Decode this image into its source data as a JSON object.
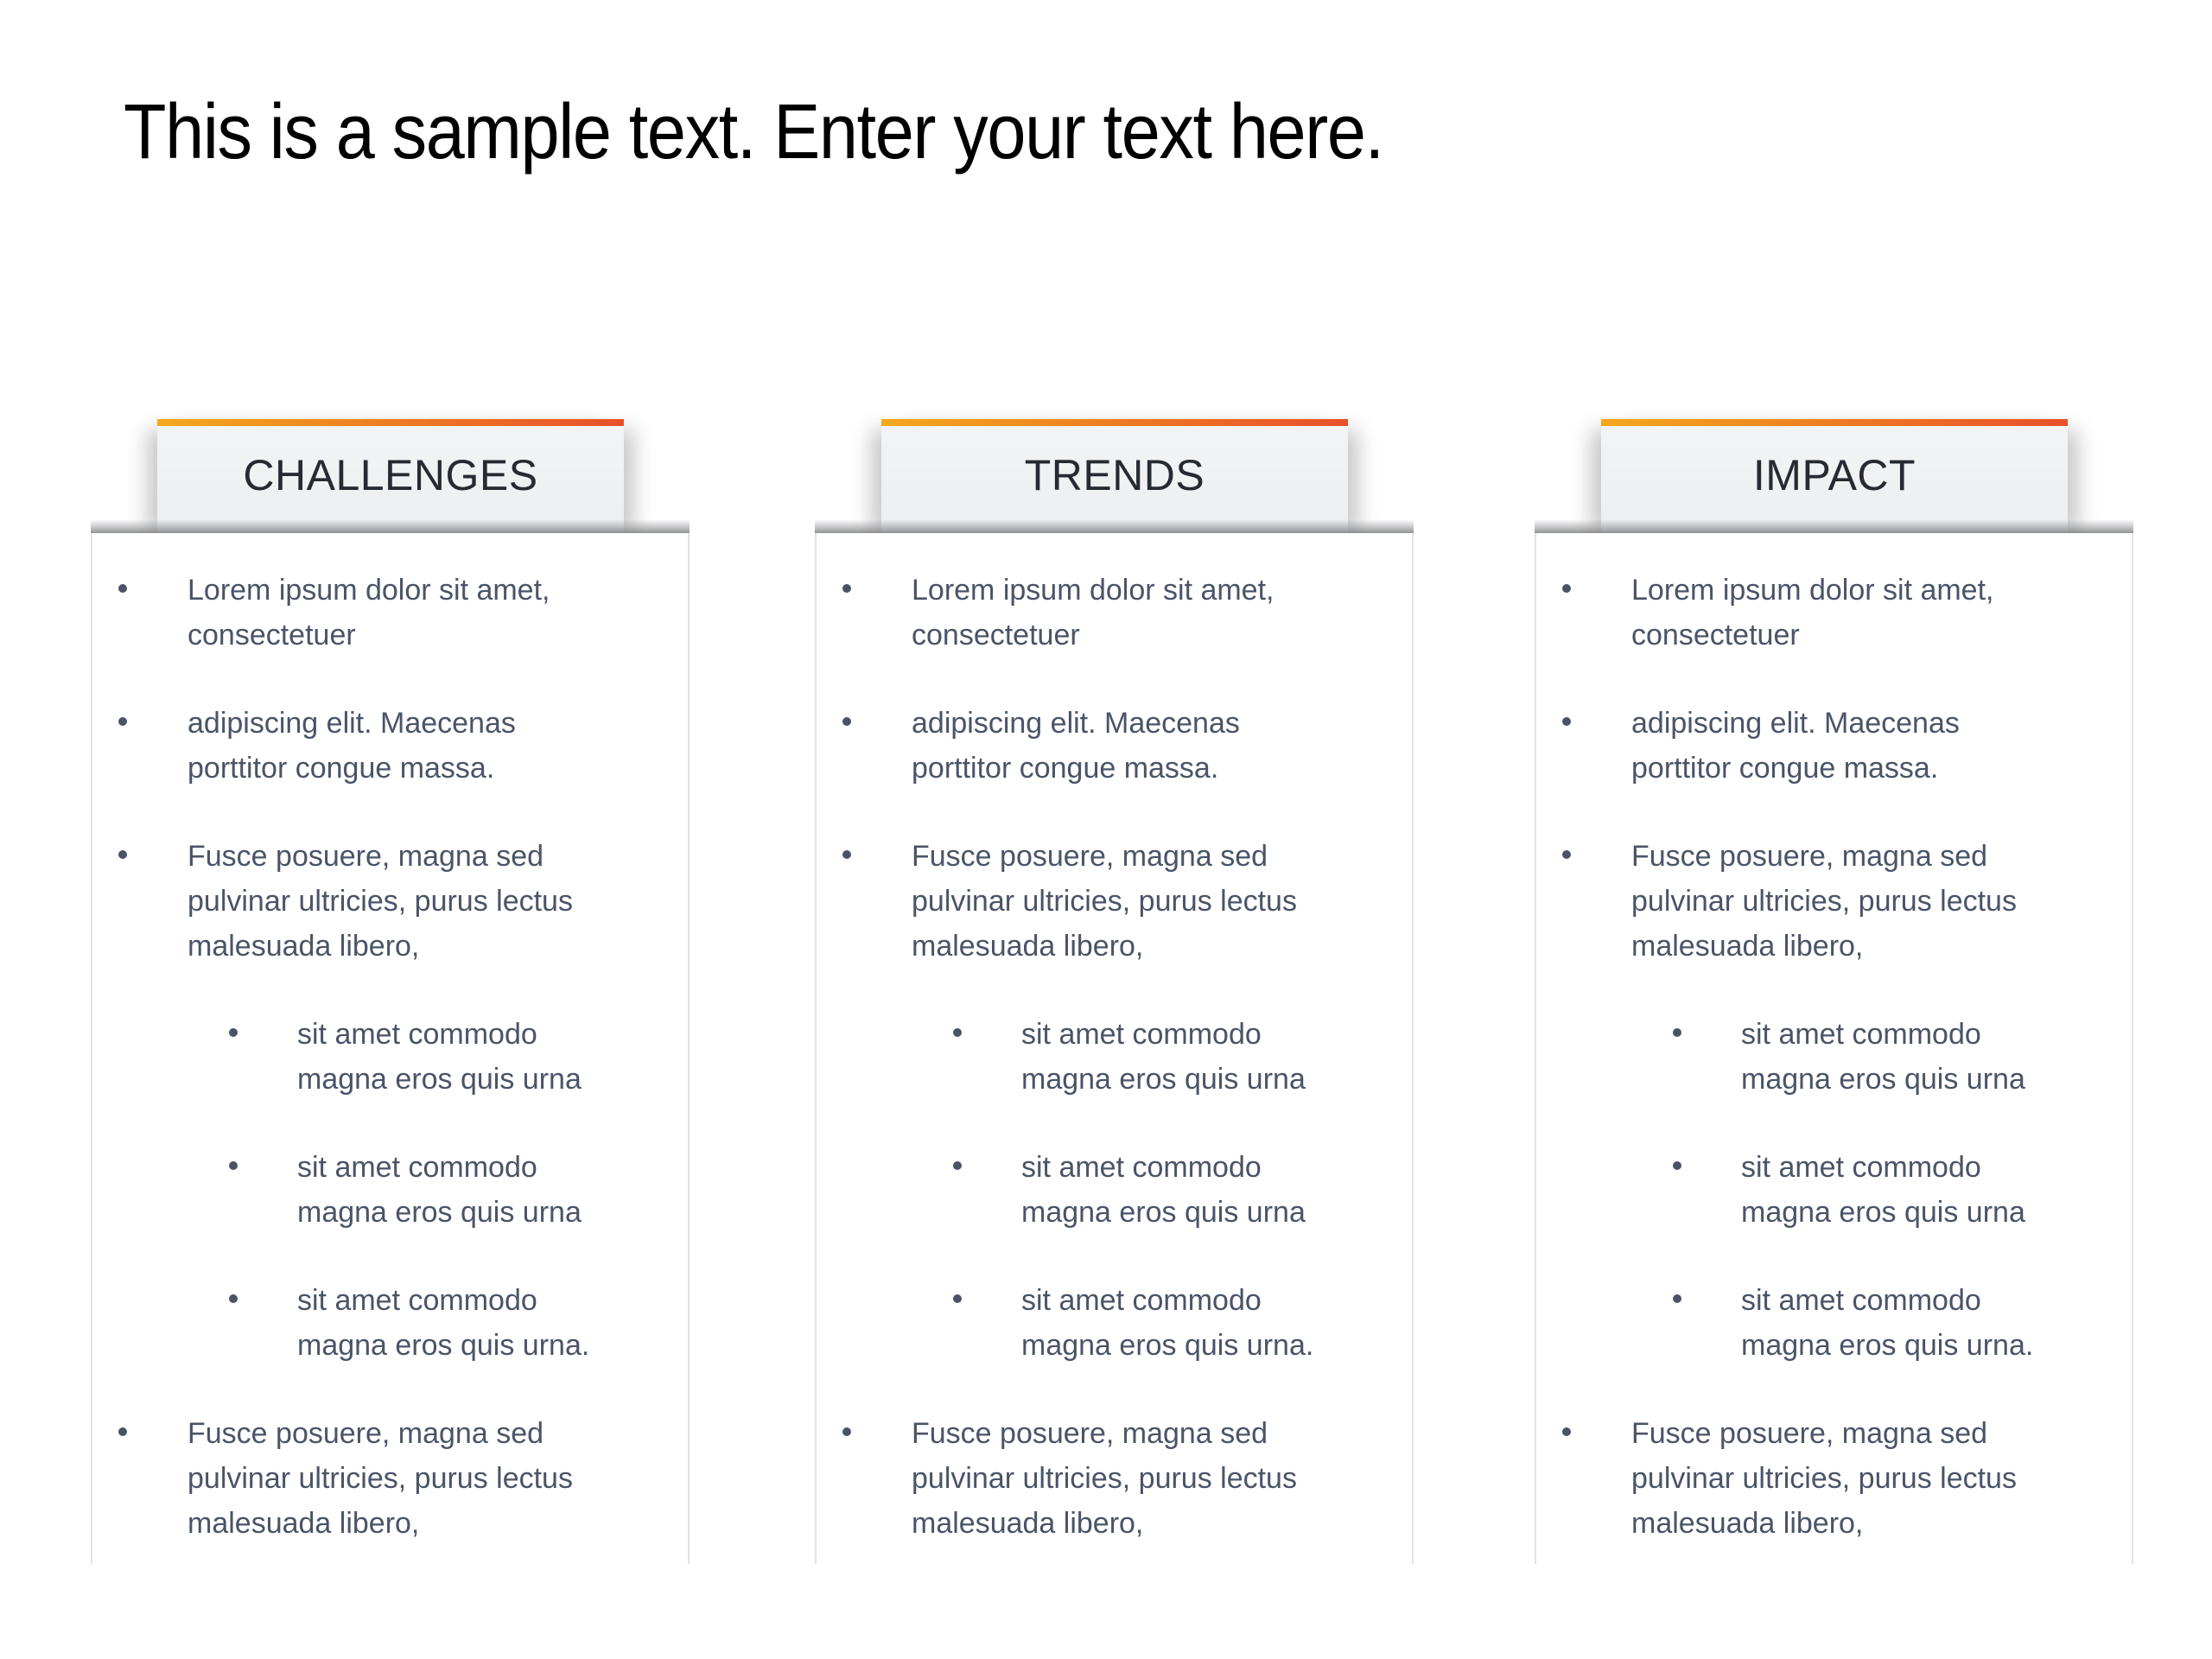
{
  "slide": {
    "title": "This is a sample text. Enter your text here."
  },
  "theme": {
    "accent_gradient_start": "#f5a81c",
    "accent_gradient_end": "#e8502a",
    "header_text_color": "#262a32",
    "body_text_color": "#4a5468"
  },
  "cards": [
    {
      "title": "CHALLENGES",
      "items": [
        {
          "level": 1,
          "text": "Lorem ipsum dolor sit amet,\nconsectetuer"
        },
        {
          "level": 1,
          "text": "adipiscing elit. Maecenas\nporttitor congue massa."
        },
        {
          "level": 1,
          "text": "Fusce posuere, magna sed\npulvinar ultricies, purus lectus\nmalesuada libero,"
        },
        {
          "level": 2,
          "text": "sit amet commodo\nmagna eros quis urna"
        },
        {
          "level": 2,
          "text": "sit amet commodo\nmagna eros quis urna"
        },
        {
          "level": 2,
          "text": "sit amet commodo\nmagna eros quis urna."
        },
        {
          "level": 1,
          "text": "Fusce posuere, magna sed\npulvinar ultricies, purus lectus\nmalesuada libero,"
        }
      ]
    },
    {
      "title": "TRENDS",
      "items": [
        {
          "level": 1,
          "text": "Lorem ipsum dolor sit amet,\nconsectetuer"
        },
        {
          "level": 1,
          "text": "adipiscing elit. Maecenas\nporttitor congue massa."
        },
        {
          "level": 1,
          "text": "Fusce posuere, magna sed\npulvinar ultricies, purus lectus\nmalesuada libero,"
        },
        {
          "level": 2,
          "text": "sit amet commodo\nmagna eros quis urna"
        },
        {
          "level": 2,
          "text": "sit amet commodo\nmagna eros quis urna"
        },
        {
          "level": 2,
          "text": "sit amet commodo\nmagna eros quis urna."
        },
        {
          "level": 1,
          "text": "Fusce posuere, magna sed\npulvinar ultricies, purus lectus\nmalesuada libero,"
        }
      ]
    },
    {
      "title": "IMPACT",
      "items": [
        {
          "level": 1,
          "text": "Lorem ipsum dolor sit amet,\nconsectetuer"
        },
        {
          "level": 1,
          "text": "adipiscing elit. Maecenas\nporttitor congue massa."
        },
        {
          "level": 1,
          "text": "Fusce posuere, magna sed\npulvinar ultricies, purus lectus\nmalesuada libero,"
        },
        {
          "level": 2,
          "text": "sit amet commodo\nmagna eros quis urna"
        },
        {
          "level": 2,
          "text": "sit amet commodo\nmagna eros quis urna"
        },
        {
          "level": 2,
          "text": "sit amet commodo\nmagna eros quis urna."
        },
        {
          "level": 1,
          "text": "Fusce posuere, magna sed\npulvinar ultricies, purus lectus\nmalesuada libero,"
        }
      ]
    }
  ]
}
